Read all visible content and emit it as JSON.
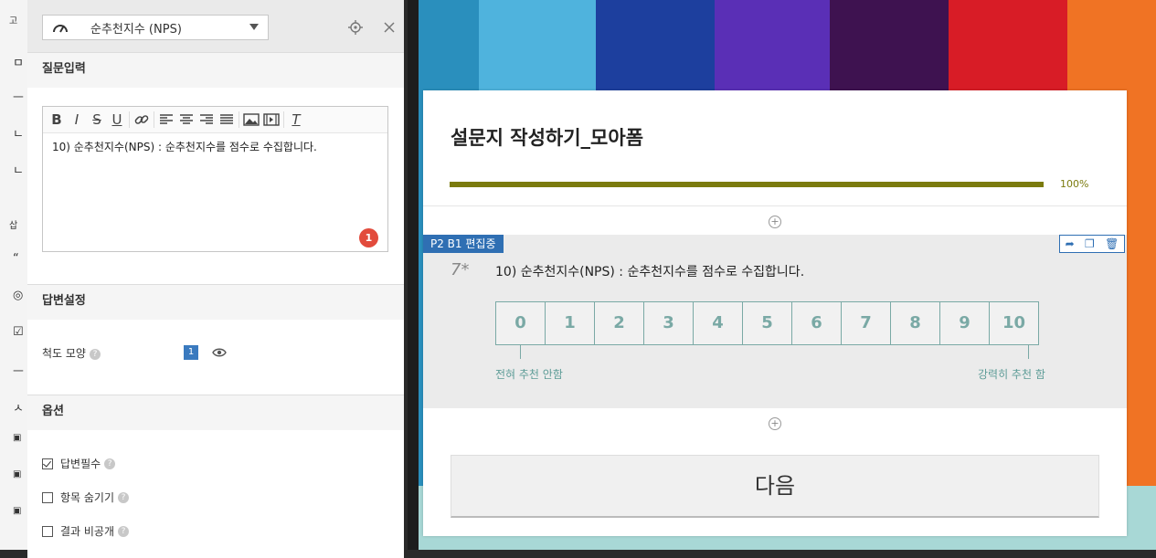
{
  "left_toolbar": {
    "items": [
      "고",
      "ㅁ",
      "ㅡ",
      "ㄴ",
      "ㄴ",
      "삽",
      "“",
      "◎",
      "☑",
      "ㅡ",
      "ㅅ",
      "▣",
      "▣",
      "▣"
    ]
  },
  "panel": {
    "question_type": "순추천지수 (NPS)",
    "section_question": "질문입력",
    "editor_text": "10) 순추천지수(NPS) : 순추천지수를 점수로 수집합니다.",
    "badge_count": "1",
    "section_answer": "답변설정",
    "scale_label": "척도 모양",
    "scale_value": "1",
    "section_options": "옵션",
    "options": {
      "required": "답변필수",
      "hide": "항목 숨기기",
      "private": "결과 비공개"
    }
  },
  "survey": {
    "title": "설문지 작성하기_모아폼",
    "progress_label": "100%",
    "progress_value": 1.0,
    "edit_tag": "P2 B1 편집중",
    "question_number": "7*",
    "question_text": "10) 순추천지수(NPS) : 순추천지수를 점수로 수집합니다.",
    "scale": [
      "0",
      "1",
      "2",
      "3",
      "4",
      "5",
      "6",
      "7",
      "8",
      "9",
      "10"
    ],
    "low_label": "전혀 추천 안함",
    "high_label": "강력히 추천 함",
    "next_button": "다음"
  },
  "colors": {
    "progress": "#7b7b0e",
    "accent": "#2f6fb3",
    "nps": "#7aa9a5",
    "badge": "#e24b3c"
  }
}
